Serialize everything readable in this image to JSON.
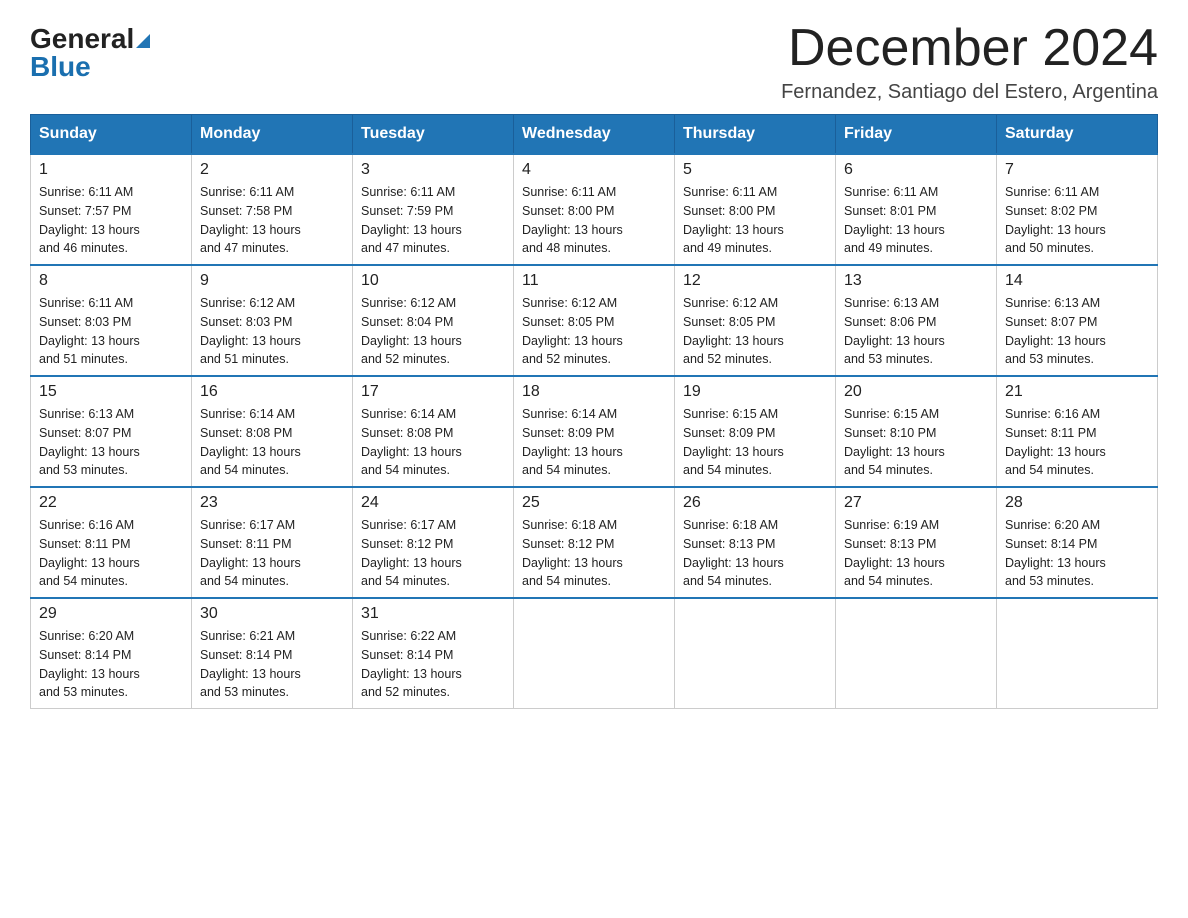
{
  "logo": {
    "general": "General",
    "blue": "Blue"
  },
  "header": {
    "title": "December 2024",
    "location": "Fernandez, Santiago del Estero, Argentina"
  },
  "days_of_week": [
    "Sunday",
    "Monday",
    "Tuesday",
    "Wednesday",
    "Thursday",
    "Friday",
    "Saturday"
  ],
  "weeks": [
    [
      {
        "day": "1",
        "sunrise": "6:11 AM",
        "sunset": "7:57 PM",
        "daylight": "13 hours and 46 minutes."
      },
      {
        "day": "2",
        "sunrise": "6:11 AM",
        "sunset": "7:58 PM",
        "daylight": "13 hours and 47 minutes."
      },
      {
        "day": "3",
        "sunrise": "6:11 AM",
        "sunset": "7:59 PM",
        "daylight": "13 hours and 47 minutes."
      },
      {
        "day": "4",
        "sunrise": "6:11 AM",
        "sunset": "8:00 PM",
        "daylight": "13 hours and 48 minutes."
      },
      {
        "day": "5",
        "sunrise": "6:11 AM",
        "sunset": "8:00 PM",
        "daylight": "13 hours and 49 minutes."
      },
      {
        "day": "6",
        "sunrise": "6:11 AM",
        "sunset": "8:01 PM",
        "daylight": "13 hours and 49 minutes."
      },
      {
        "day": "7",
        "sunrise": "6:11 AM",
        "sunset": "8:02 PM",
        "daylight": "13 hours and 50 minutes."
      }
    ],
    [
      {
        "day": "8",
        "sunrise": "6:11 AM",
        "sunset": "8:03 PM",
        "daylight": "13 hours and 51 minutes."
      },
      {
        "day": "9",
        "sunrise": "6:12 AM",
        "sunset": "8:03 PM",
        "daylight": "13 hours and 51 minutes."
      },
      {
        "day": "10",
        "sunrise": "6:12 AM",
        "sunset": "8:04 PM",
        "daylight": "13 hours and 52 minutes."
      },
      {
        "day": "11",
        "sunrise": "6:12 AM",
        "sunset": "8:05 PM",
        "daylight": "13 hours and 52 minutes."
      },
      {
        "day": "12",
        "sunrise": "6:12 AM",
        "sunset": "8:05 PM",
        "daylight": "13 hours and 52 minutes."
      },
      {
        "day": "13",
        "sunrise": "6:13 AM",
        "sunset": "8:06 PM",
        "daylight": "13 hours and 53 minutes."
      },
      {
        "day": "14",
        "sunrise": "6:13 AM",
        "sunset": "8:07 PM",
        "daylight": "13 hours and 53 minutes."
      }
    ],
    [
      {
        "day": "15",
        "sunrise": "6:13 AM",
        "sunset": "8:07 PM",
        "daylight": "13 hours and 53 minutes."
      },
      {
        "day": "16",
        "sunrise": "6:14 AM",
        "sunset": "8:08 PM",
        "daylight": "13 hours and 54 minutes."
      },
      {
        "day": "17",
        "sunrise": "6:14 AM",
        "sunset": "8:08 PM",
        "daylight": "13 hours and 54 minutes."
      },
      {
        "day": "18",
        "sunrise": "6:14 AM",
        "sunset": "8:09 PM",
        "daylight": "13 hours and 54 minutes."
      },
      {
        "day": "19",
        "sunrise": "6:15 AM",
        "sunset": "8:09 PM",
        "daylight": "13 hours and 54 minutes."
      },
      {
        "day": "20",
        "sunrise": "6:15 AM",
        "sunset": "8:10 PM",
        "daylight": "13 hours and 54 minutes."
      },
      {
        "day": "21",
        "sunrise": "6:16 AM",
        "sunset": "8:11 PM",
        "daylight": "13 hours and 54 minutes."
      }
    ],
    [
      {
        "day": "22",
        "sunrise": "6:16 AM",
        "sunset": "8:11 PM",
        "daylight": "13 hours and 54 minutes."
      },
      {
        "day": "23",
        "sunrise": "6:17 AM",
        "sunset": "8:11 PM",
        "daylight": "13 hours and 54 minutes."
      },
      {
        "day": "24",
        "sunrise": "6:17 AM",
        "sunset": "8:12 PM",
        "daylight": "13 hours and 54 minutes."
      },
      {
        "day": "25",
        "sunrise": "6:18 AM",
        "sunset": "8:12 PM",
        "daylight": "13 hours and 54 minutes."
      },
      {
        "day": "26",
        "sunrise": "6:18 AM",
        "sunset": "8:13 PM",
        "daylight": "13 hours and 54 minutes."
      },
      {
        "day": "27",
        "sunrise": "6:19 AM",
        "sunset": "8:13 PM",
        "daylight": "13 hours and 54 minutes."
      },
      {
        "day": "28",
        "sunrise": "6:20 AM",
        "sunset": "8:14 PM",
        "daylight": "13 hours and 53 minutes."
      }
    ],
    [
      {
        "day": "29",
        "sunrise": "6:20 AM",
        "sunset": "8:14 PM",
        "daylight": "13 hours and 53 minutes."
      },
      {
        "day": "30",
        "sunrise": "6:21 AM",
        "sunset": "8:14 PM",
        "daylight": "13 hours and 53 minutes."
      },
      {
        "day": "31",
        "sunrise": "6:22 AM",
        "sunset": "8:14 PM",
        "daylight": "13 hours and 52 minutes."
      },
      null,
      null,
      null,
      null
    ]
  ],
  "labels": {
    "sunrise": "Sunrise:",
    "sunset": "Sunset:",
    "daylight": "Daylight:"
  }
}
